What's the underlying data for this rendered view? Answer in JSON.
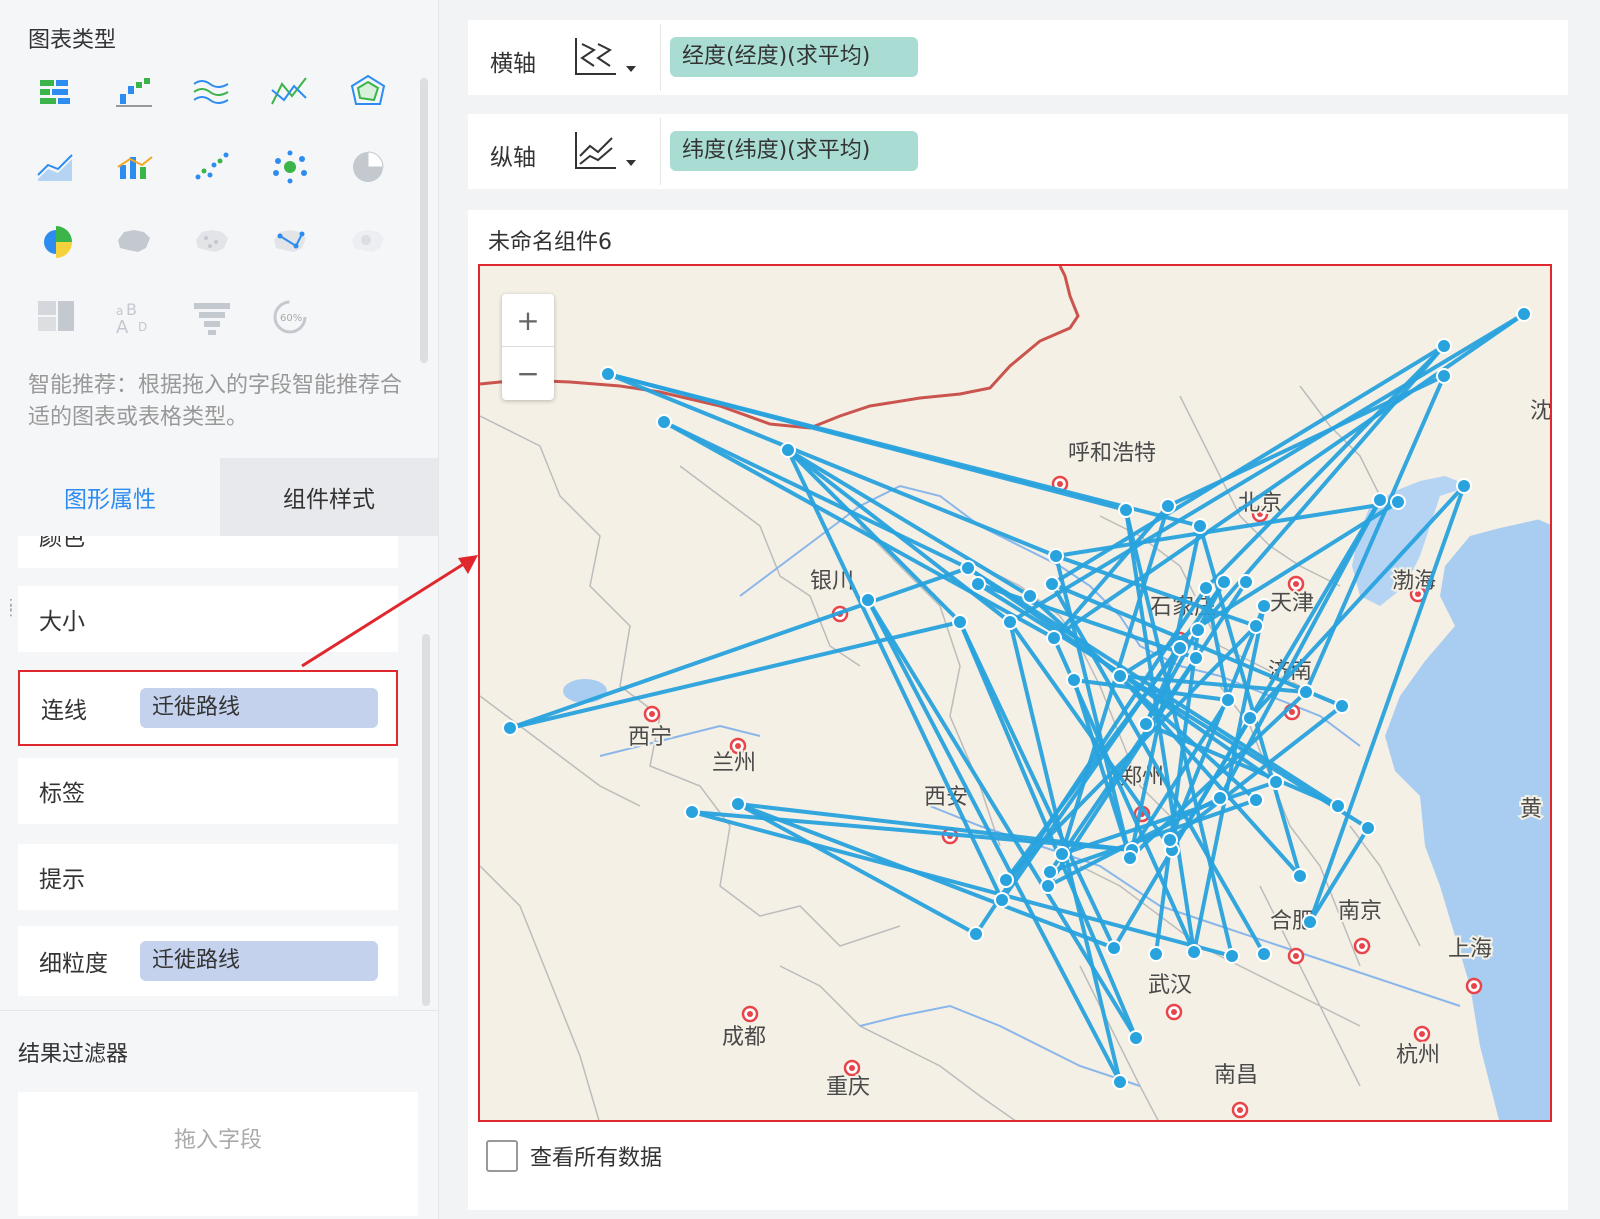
{
  "left_panel": {
    "chart_type_title": "图表类型",
    "chart_type_icons": [
      "bar-chart-icon",
      "stacked-bar-icon",
      "area-chart-icon",
      "line-chart-icon",
      "radar-chart-icon",
      "line-area-icon",
      "combo-chart-icon",
      "scatter-chart-icon",
      "bubble-chart-icon",
      "pie-chart-icon",
      "rose-chart-icon",
      "filled-map-icon",
      "point-map-icon",
      "flow-map-icon",
      "heat-map-icon",
      "treemap-icon",
      "word-cloud-icon",
      "funnel-chart-icon",
      "gauge-chart-icon"
    ],
    "hint": "智能推荐：根据拖入的字段智能推荐合适的图表或表格类型。",
    "tabs": {
      "shape": "图形属性",
      "style": "组件样式"
    },
    "props": [
      {
        "label": "颜色"
      },
      {
        "label": "大小"
      },
      {
        "label": "连线",
        "value": "迁徙路线"
      },
      {
        "label": "标签"
      },
      {
        "label": "提示"
      },
      {
        "label": "细粒度",
        "value": "迁徙路线"
      }
    ],
    "filter_title": "结果过滤器",
    "filter_placeholder": "拖入字段"
  },
  "main": {
    "x_axis": {
      "label": "横轴",
      "field": "经度(经度)(求平均)"
    },
    "y_axis": {
      "label": "纵轴",
      "field": "纬度(纬度)(求平均)"
    },
    "widget_title": "未命名组件6",
    "zoom_in": "+",
    "zoom_out": "−",
    "view_all_label": "查看所有数据"
  },
  "map": {
    "line_color": "#29a3de",
    "cities": [
      "呼和浩特",
      "北京",
      "银川",
      "天津",
      "石家庄",
      "渤海",
      "西宁",
      "兰州",
      "郑州",
      "西安",
      "济南",
      "黄",
      "合肥",
      "南京",
      "上海",
      "武汉",
      "成都",
      "重庆",
      "南昌",
      "杭州",
      "沈"
    ]
  }
}
